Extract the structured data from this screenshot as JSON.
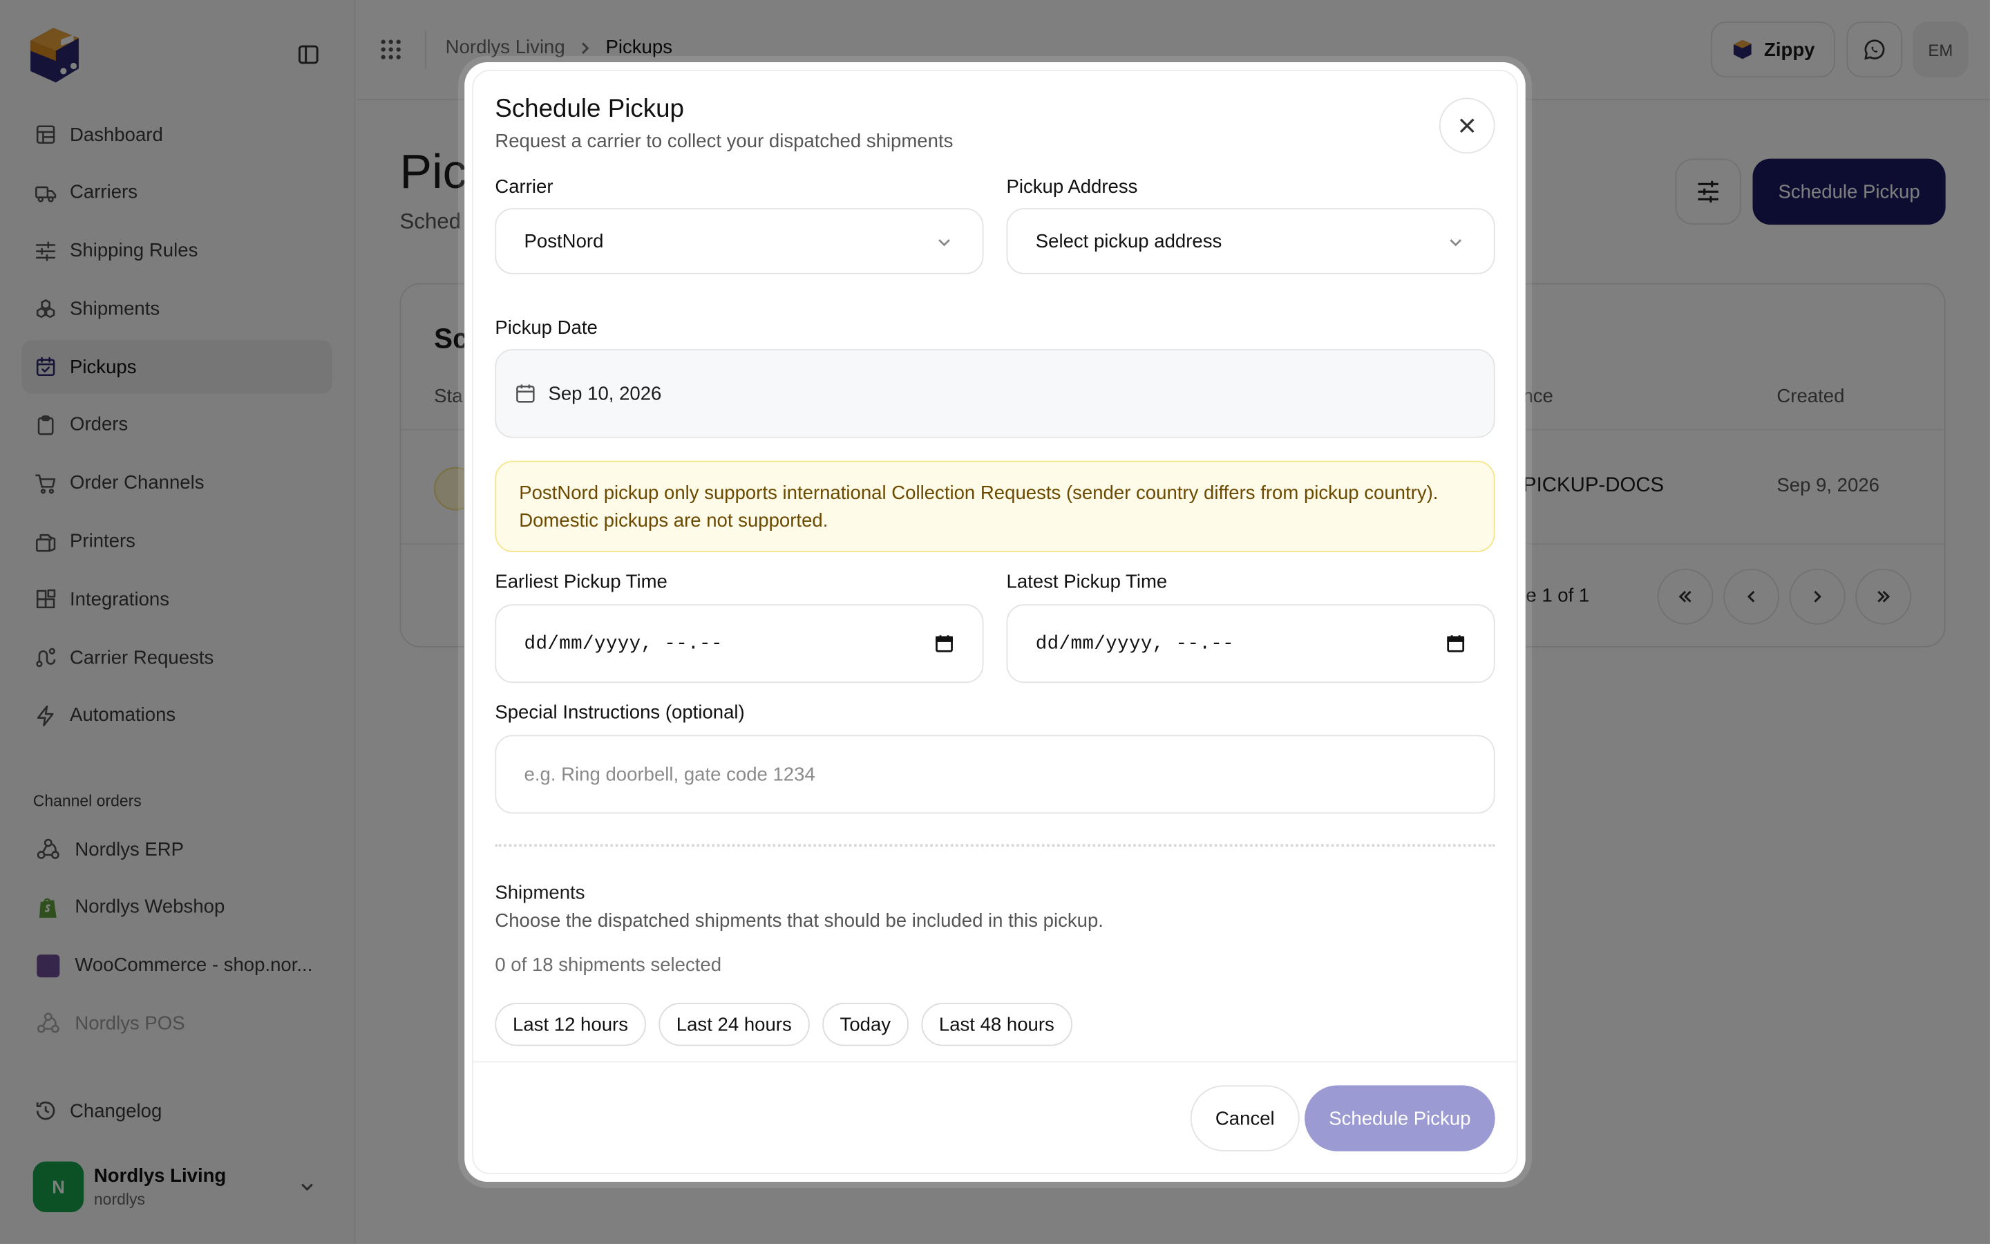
{
  "sidebar": {
    "nav": [
      {
        "label": "Dashboard",
        "icon": "dashboard-icon"
      },
      {
        "label": "Carriers",
        "icon": "truck-icon"
      },
      {
        "label": "Shipping Rules",
        "icon": "sliders-icon"
      },
      {
        "label": "Shipments",
        "icon": "boxes-icon"
      },
      {
        "label": "Pickups",
        "icon": "calendar-check-icon",
        "active": true
      },
      {
        "label": "Orders",
        "icon": "clipboard-icon"
      },
      {
        "label": "Order Channels",
        "icon": "cart-icon"
      },
      {
        "label": "Printers",
        "icon": "printer-icon"
      },
      {
        "label": "Integrations",
        "icon": "blocks-icon"
      },
      {
        "label": "Carrier Requests",
        "icon": "route-icon"
      },
      {
        "label": "Automations",
        "icon": "zap-icon"
      }
    ],
    "channels_label": "Channel orders",
    "channels": [
      {
        "label": "Nordlys ERP",
        "icon": "webhook-icon"
      },
      {
        "label": "Nordlys Webshop",
        "icon": "shopify-icon"
      },
      {
        "label": "WooCommerce - shop.nor...",
        "icon": "woocommerce-icon"
      },
      {
        "label": "Nordlys POS",
        "icon": "webhook-icon",
        "dim": true
      }
    ],
    "changelog": "Changelog",
    "account": {
      "initial": "N",
      "name": "Nordlys Living",
      "handle": "nordlys"
    }
  },
  "topbar": {
    "breadcrumb": [
      "Nordlys Living",
      "Pickups"
    ],
    "zippy_label": "Zippy",
    "user_initials": "EM"
  },
  "page": {
    "title": "Pic",
    "subtitle": "Sched",
    "schedule_button": "Schedule Pickup",
    "card": {
      "title": "Sc",
      "headers": {
        "status": "Sta",
        "reference": "erence",
        "created": "Created"
      },
      "row": {
        "reference": "PICKUP-DOCS",
        "created": "Sep 9, 2026"
      },
      "pager_text": "ge 1 of 1"
    }
  },
  "modal": {
    "title": "Schedule Pickup",
    "subtitle": "Request a carrier to collect your dispatched shipments",
    "carrier_label": "Carrier",
    "carrier_value": "PostNord",
    "address_label": "Pickup Address",
    "address_placeholder": "Select pickup address",
    "date_label": "Pickup Date",
    "date_value": "Sep 10, 2026",
    "warning_line1": "PostNord pickup only supports international Collection Requests (sender country differs from pickup country).",
    "warning_line2": "Domestic pickups are not supported.",
    "earliest_label": "Earliest Pickup Time",
    "earliest_value": "dd/mm/yyyy, --.--",
    "latest_label": "Latest Pickup Time",
    "latest_value": "dd/mm/yyyy, --.--",
    "instructions_label": "Special Instructions (optional)",
    "instructions_placeholder": "e.g. Ring doorbell, gate code 1234",
    "shipments_title": "Shipments",
    "shipments_subtitle": "Choose the dispatched shipments that should be included in this pickup.",
    "shipments_count": "0 of 18 shipments selected",
    "chips": [
      "Last 12 hours",
      "Last 24 hours",
      "Today",
      "Last 48 hours"
    ],
    "cancel_label": "Cancel",
    "submit_label": "Schedule Pickup"
  },
  "colors": {
    "primary": "#1b1a63",
    "primary_disabled": "#9b9ad3",
    "warning_bg": "#fefbe8",
    "warning_text": "#6b4a00",
    "account_green": "#16a34a"
  }
}
